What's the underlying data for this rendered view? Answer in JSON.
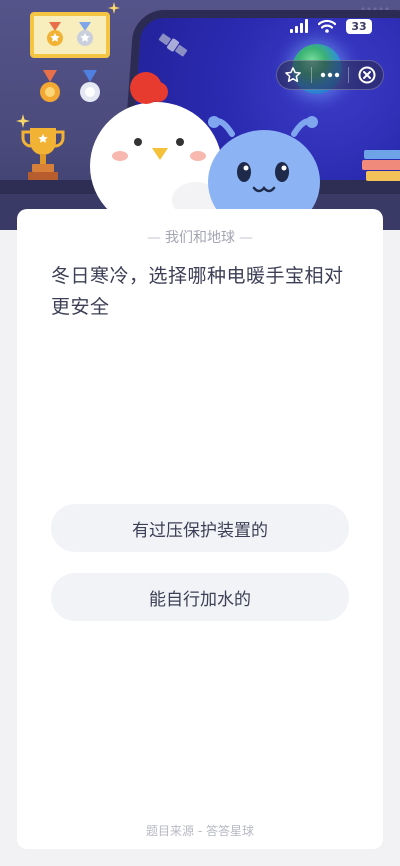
{
  "status_bar": {
    "battery": "33",
    "signal_icon": "signal-icon",
    "wifi_icon": "wifi-icon"
  },
  "capsule": {
    "favorite_icon": "star-icon",
    "more_icon": "more-dots-icon",
    "close_icon": "close-circle-icon"
  },
  "quiz": {
    "subject": "我们和地球",
    "question": "冬日寒冷，选择哪种电暖手宝相对更安全",
    "options": [
      {
        "label": "有过压保护装置的"
      },
      {
        "label": "能自行加水的"
      }
    ],
    "source": "题目来源 - 答答星球"
  },
  "colors": {
    "scene_bg": "#4a4a7c",
    "card_bg": "#ffffff",
    "option_bg": "#f2f3f6",
    "text_primary": "#3c3f55",
    "text_muted": "#a3a6b3"
  }
}
